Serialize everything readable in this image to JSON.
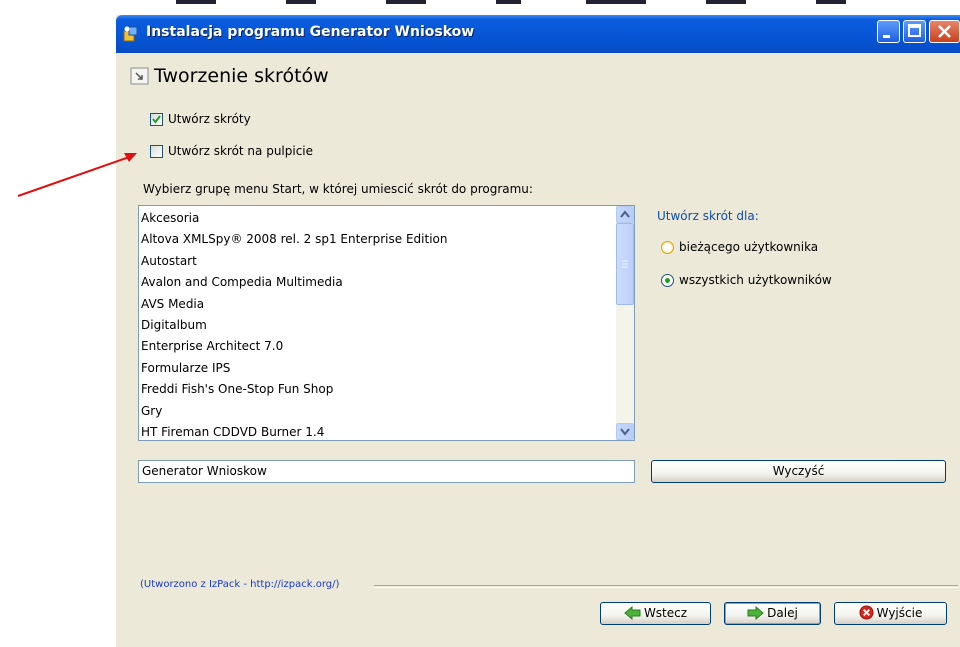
{
  "window": {
    "title": "Instalacja programu Generator Wnioskow",
    "buttons": [
      "minimize",
      "maximize",
      "close"
    ]
  },
  "header": {
    "icon": "shortcut-icon",
    "title": "Tworzenie skrótów"
  },
  "checkboxes": [
    {
      "label": "Utwórz skróty",
      "checked": true
    },
    {
      "label": "Utwórz skrót na pulpicie",
      "checked": false
    }
  ],
  "program_group": {
    "label": "Wybierz grupę menu Start, w której umiescić skrót do programu:",
    "items": [
      "Akcesoria",
      "Altova XMLSpy® 2008 rel. 2 sp1 Enterprise Edition",
      "Autostart",
      "Avalon and Compedia Multimedia",
      "AVS Media",
      "Digitalbum",
      "Enterprise Architect 7.0",
      "Formularze IPS",
      "Freddi Fish's One-Stop Fun Shop",
      "Gry",
      "HT Fireman CDDVD Burner 1.4"
    ],
    "name_value": "Generator Wnioskow",
    "clear_label": "Wyczyść"
  },
  "shortcut_for": {
    "label": "Utwórz skrót dla:",
    "options": [
      {
        "label": "bieżącego użytkownika",
        "selected": false
      },
      {
        "label": "wszystkich użytkowników",
        "selected": true
      }
    ]
  },
  "footer": {
    "credit": "(Utworzono z IzPack - http://izpack.org/)"
  },
  "nav_buttons": {
    "back": "Wstecz",
    "next": "Dalej",
    "exit": "Wyjście"
  },
  "colors": {
    "titlebar": "#0757d7",
    "annotation_arrow": "#e01010",
    "link_text": "#0b4fab"
  }
}
